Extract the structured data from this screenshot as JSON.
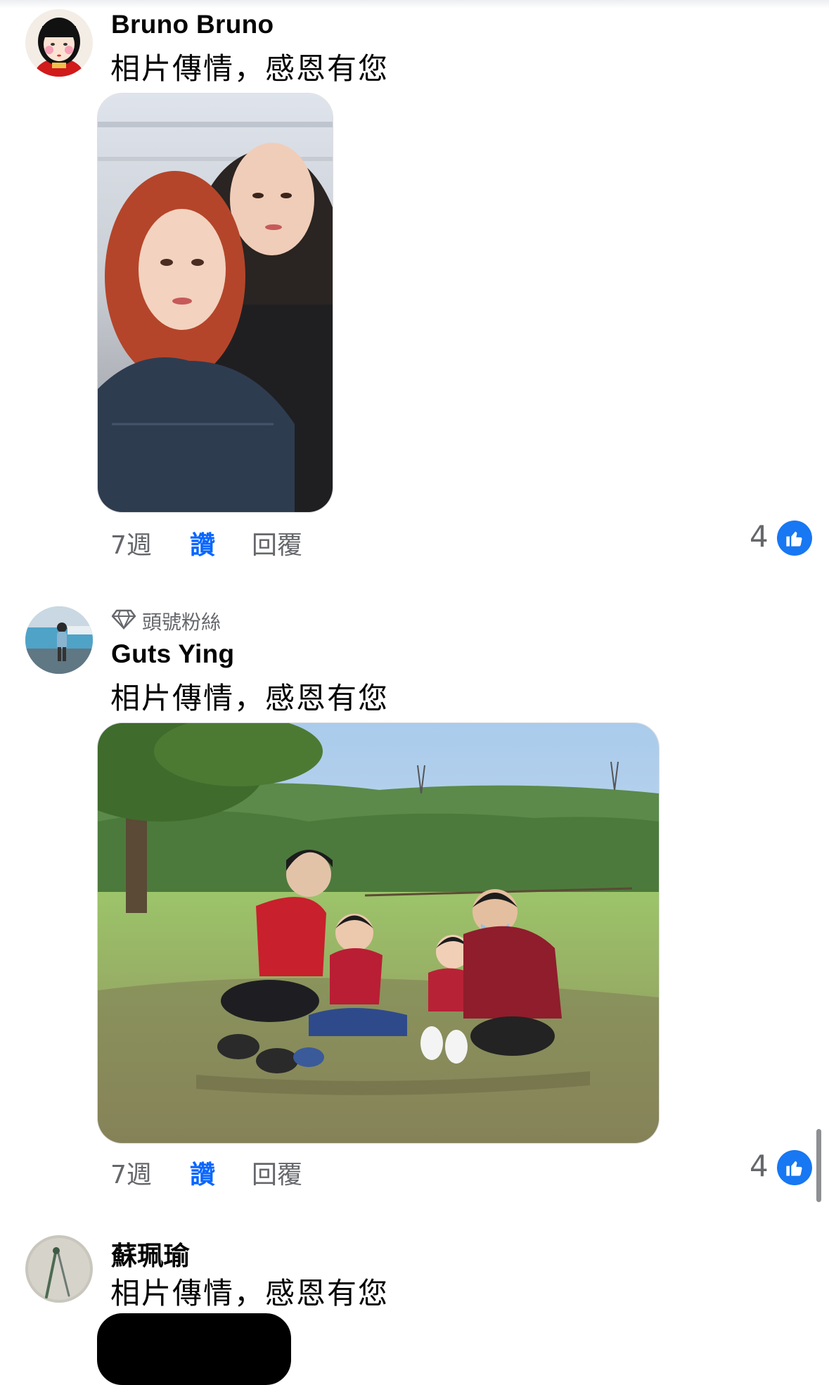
{
  "comments": [
    {
      "author": "Bruno Bruno",
      "text": "相片傳情，感恩有您",
      "time": "7週",
      "like_label": "讚",
      "reply_label": "回覆",
      "reaction_count": "4",
      "reaction_icon": "like-icon",
      "avatar_icon": "cartoon-girl-avatar"
    },
    {
      "badge": "頭號粉絲",
      "badge_icon": "diamond-icon",
      "author": "Guts Ying",
      "text": "相片傳情，感恩有您",
      "time": "7週",
      "like_label": "讚",
      "reply_label": "回覆",
      "reaction_count": "4",
      "reaction_icon": "like-icon",
      "avatar_icon": "child-by-pool-avatar"
    },
    {
      "author": "蘇珮瑜",
      "text": "相片傳情，感恩有您",
      "avatar_icon": "walking-stick-avatar"
    }
  ],
  "colors": {
    "link_blue": "#0866ff",
    "like_bubble": "#1877f2",
    "secondary_text": "#65676b"
  }
}
